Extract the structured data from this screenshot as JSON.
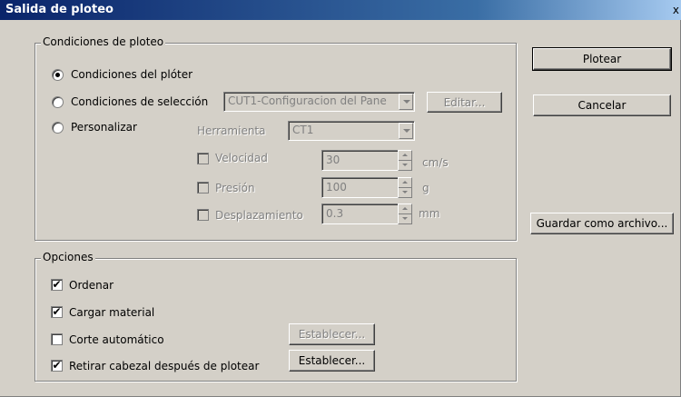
{
  "window": {
    "title": "Salida de ploteo",
    "close_glyph": "x"
  },
  "conditions": {
    "legend": "Condiciones de ploteo",
    "plotter_label": "Condiciones del plóter",
    "selection_label": "Condiciones de selección",
    "selection_value": "CUT1-Configuracion del Pane",
    "edit_label": "Editar...",
    "custom_label": "Personalizar",
    "tool_label": "Herramienta",
    "tool_value": "CT1",
    "speed_label": "Velocidad",
    "speed_value": "30",
    "speed_unit": "cm/s",
    "pressure_label": "Presión",
    "pressure_value": "100",
    "pressure_unit": "g",
    "offset_label": "Desplazamiento",
    "offset_value": "0.3",
    "offset_unit": "mm",
    "selected": "plotter"
  },
  "options": {
    "legend": "Opciones",
    "sort_label": "Ordenar",
    "sort_checked": true,
    "load_label": "Cargar material",
    "load_checked": true,
    "autocut_label": "Corte automático",
    "autocut_checked": false,
    "autocut_set_label": "Establecer...",
    "lift_label": "Retirar cabezal después de plotear",
    "lift_checked": true,
    "lift_set_label": "Establecer..."
  },
  "buttons": {
    "plot_label": "Plotear",
    "cancel_label": "Cancelar",
    "save_label": "Guardar como archivo..."
  },
  "glyphs": {
    "check": "✔"
  }
}
